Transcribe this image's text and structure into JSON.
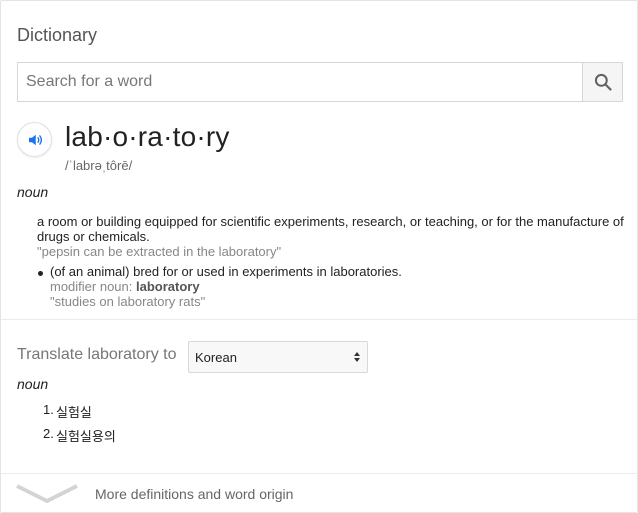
{
  "header": {
    "title": "Dictionary"
  },
  "search": {
    "placeholder": "Search for a word",
    "value": ""
  },
  "entry": {
    "headword": "lab·o·ra·to·ry",
    "phonetic": "/ˈlabrəˌtôrē/",
    "pos": "noun",
    "sense1": {
      "definition": "a room or building equipped for scientific experiments, research, or teaching, or for the manufacture of drugs or chemicals.",
      "example": "\"pepsin can be extracted in the laboratory\""
    },
    "sense1_sub": {
      "definition": "(of an animal) bred for or used in experiments in laboratories.",
      "modifier_prefix": "modifier noun: ",
      "modifier_word": "laboratory",
      "example": "\"studies on laboratory rats\""
    }
  },
  "translate": {
    "label": "Translate laboratory to",
    "language": "Korean",
    "pos": "noun",
    "items": [
      {
        "num": "1.",
        "text": "실험실"
      },
      {
        "num": "2.",
        "text": "실험실용의"
      }
    ]
  },
  "footer": {
    "more_label": "More definitions and word origin"
  },
  "colors": {
    "accent": "#1a73e8",
    "gray_text": "#878787",
    "border": "#d6d6d6"
  },
  "icons": {
    "search": "search-icon",
    "speaker": "speaker-icon",
    "chevron": "chevron-down-icon"
  }
}
